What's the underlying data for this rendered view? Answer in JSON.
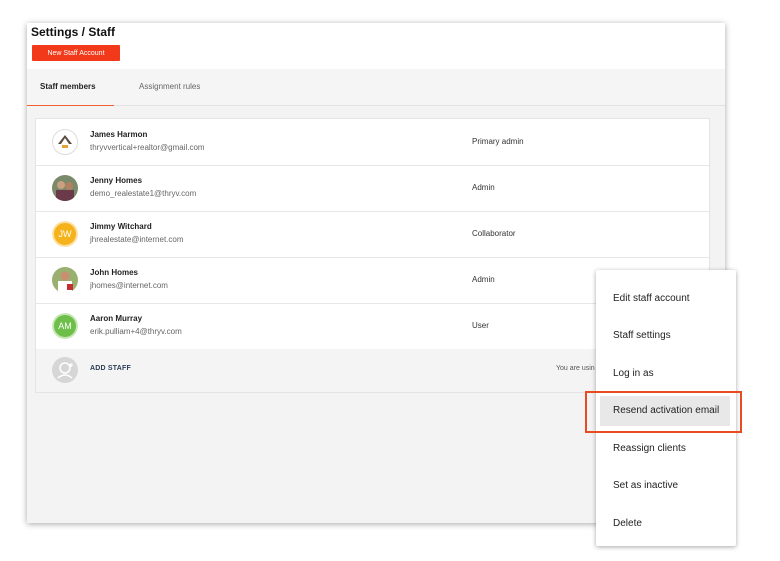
{
  "page": {
    "title": "Settings / Staff",
    "new_button": "New Staff Account"
  },
  "tabs": [
    {
      "label": "Staff members",
      "active": true
    },
    {
      "label": "Assignment rules",
      "active": false
    }
  ],
  "staff": [
    {
      "name": "James Harmon",
      "email": "thryvvertical+realtor@gmail.com",
      "role": "Primary admin",
      "avatar": "logo"
    },
    {
      "name": "Jenny Homes",
      "email": "demo_realestate1@thryv.com",
      "role": "Admin",
      "avatar": "photo"
    },
    {
      "name": "Jimmy Witchard",
      "email": "jhrealestate@internet.com",
      "role": "Collaborator",
      "avatar": "initials",
      "initials": "JW",
      "color": "#f5b21b"
    },
    {
      "name": "John Homes",
      "email": "jhomes@internet.com",
      "role": "Admin",
      "avatar": "photo"
    },
    {
      "name": "Aaron Murray",
      "email": "erik.pulliam+4@thryv.com",
      "role": "User",
      "avatar": "initials",
      "initials": "AM",
      "color": "#6dbf4a"
    }
  ],
  "add_staff": {
    "label": "ADD STAFF",
    "note": "You are usin"
  },
  "context_menu": {
    "items": [
      {
        "label": "Edit staff account"
      },
      {
        "label": "Staff settings"
      },
      {
        "label": "Log in as"
      },
      {
        "label": "Resend activation email",
        "highlighted": true
      },
      {
        "label": "Reassign clients"
      },
      {
        "label": "Set as inactive"
      },
      {
        "label": "Delete"
      }
    ]
  },
  "colors": {
    "accent": "#f23a1a",
    "highlight_box": "#e84a21",
    "tab_underline": "#f06030"
  },
  "icons": {
    "add_staff": "user-plus-icon"
  }
}
